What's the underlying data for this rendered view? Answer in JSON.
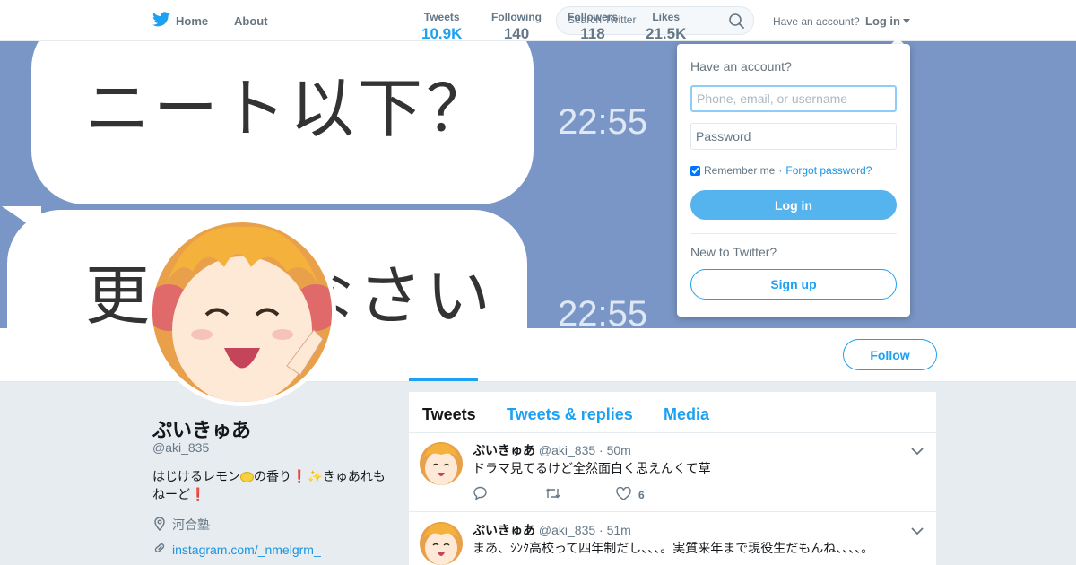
{
  "nav": {
    "home_label": "Home",
    "about_label": "About",
    "search_placeholder": "Search Twitter",
    "have_account": "Have an account?",
    "login_label": "Log in",
    "brand_color": "#1da1f2"
  },
  "banner": {
    "line1": "ニート以下？",
    "line2": "更新しなさい",
    "time1": "22:55",
    "time2": "22:55",
    "background_color": "#7a96c6"
  },
  "profile": {
    "name": "ぷいきゅあ",
    "handle": "@aki_835",
    "bio_part1": "はじけるレモン",
    "bio_part2": "の香り",
    "bio_exclaim1": "❗",
    "bio_spark": "✨",
    "bio_part3": "きゅあれもねーど",
    "bio_exclaim2": "❗",
    "location": "河合塾",
    "link": "instagram.com/_nmelgrm_"
  },
  "stats": [
    {
      "label": "Tweets",
      "value": "10.9K"
    },
    {
      "label": "Following",
      "value": "140"
    },
    {
      "label": "Followers",
      "value": "118"
    },
    {
      "label": "Likes",
      "value": "21.5K"
    }
  ],
  "follow_label": "Follow",
  "timeline": {
    "tabs": [
      "Tweets",
      "Tweets & replies",
      "Media"
    ],
    "tweets": [
      {
        "name": "ぷいきゅあ",
        "handle": "@aki_835",
        "time": "· 50m",
        "text": "ドラマ見てるけど全然面白く思えんくて草",
        "likes": "6"
      },
      {
        "name": "ぷいきゅあ",
        "handle": "@aki_835",
        "time": "· 51m",
        "text": "まあ、ｼﾝｸ高校って四年制だし、、、。実質来年まで現役生だもんね、、、、。"
      }
    ]
  },
  "login_dropdown": {
    "title": "Have an account?",
    "username_placeholder": "Phone, email, or username",
    "password_placeholder": "Password",
    "remember_label": "Remember me",
    "separator": "·",
    "forgot_label": "Forgot password?",
    "login_button": "Log in",
    "new_to_twitter": "New to Twitter?",
    "signup_button": "Sign up"
  }
}
